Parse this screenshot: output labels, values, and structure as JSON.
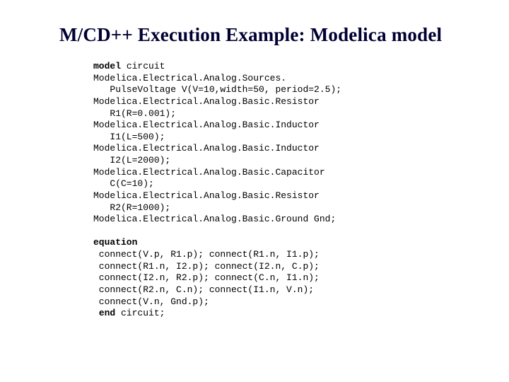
{
  "title": "M/CD++ Execution Example: Modelica model",
  "code": {
    "l01a": "model",
    "l01b": " circuit",
    "l02": "Modelica.Electrical.Analog.Sources.",
    "l03": "   PulseVoltage V(V=10,width=50, period=2.5);",
    "l04": "Modelica.Electrical.Analog.Basic.Resistor",
    "l05": "   R1(R=0.001);",
    "l06": "Modelica.Electrical.Analog.Basic.Inductor",
    "l07": "   I1(L=500);",
    "l08": "Modelica.Electrical.Analog.Basic.Inductor",
    "l09": "   I2(L=2000);",
    "l10": "Modelica.Electrical.Analog.Basic.Capacitor",
    "l11": "   C(C=10);",
    "l12": "Modelica.Electrical.Analog.Basic.Resistor",
    "l13": "   R2(R=1000);",
    "l14": "Modelica.Electrical.Analog.Basic.Ground Gnd;",
    "l15": "",
    "l16": "equation",
    "l17": " connect(V.p, R1.p); connect(R1.n, I1.p);",
    "l18": " connect(R1.n, I2.p); connect(I2.n, C.p);",
    "l19": " connect(I2.n, R2.p); connect(C.n, I1.n);",
    "l20": " connect(R2.n, C.n); connect(I1.n, V.n);",
    "l21": " connect(V.n, Gnd.p);",
    "l22a": " ",
    "l22b": "end",
    "l22c": " circuit;"
  }
}
